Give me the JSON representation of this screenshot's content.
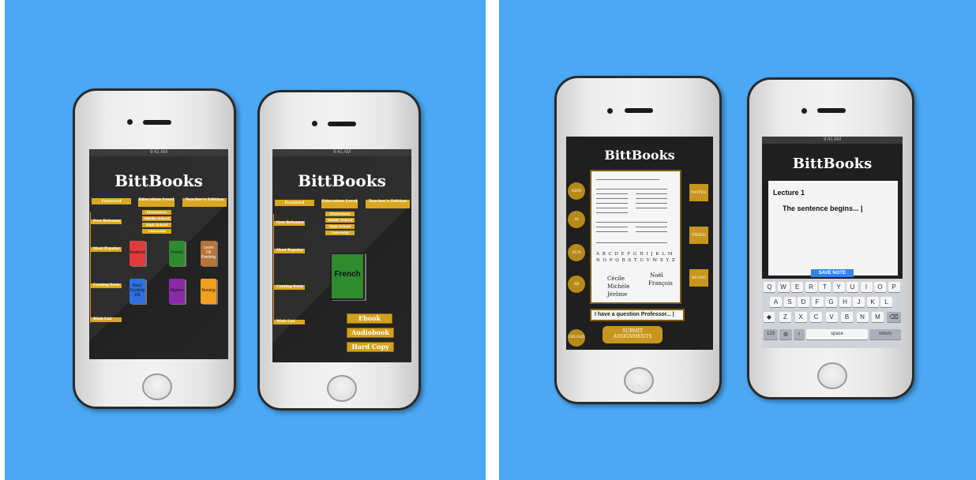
{
  "app_name": "BittBooks",
  "status_time": "9:41 AM",
  "phone1": {
    "tabs": [
      "Featured",
      "Education Level",
      "Teacher's Edition"
    ],
    "education_levels": [
      "Elementary",
      "Middle School",
      "High School",
      "University"
    ],
    "sidebar": [
      "New Releases",
      "Most Popular",
      "Coming Soon",
      "Wish List"
    ],
    "books": [
      {
        "title": "Anatomy",
        "color": "#e23a3a"
      },
      {
        "title": "French",
        "color": "#2e8b2e"
      },
      {
        "title": "Learn Oil Painting",
        "color": "#b8743a"
      },
      {
        "title": "Easy Cooking 101",
        "color": "#2f6fe0"
      },
      {
        "title": "Algebra",
        "color": "#8a2aa8"
      },
      {
        "title": "Nursing",
        "color": "#f0a020"
      }
    ]
  },
  "phone2": {
    "tabs": [
      "Featured",
      "Education Level",
      "Teacher's Edition"
    ],
    "education_levels": [
      "Elementary",
      "Middle School",
      "High School",
      "University"
    ],
    "sidebar": [
      "New Releases",
      "Most Popular",
      "Coming Soon",
      "Wish List"
    ],
    "selected_book": {
      "title": "French",
      "color": "#2e8b2e"
    },
    "formats": [
      "Ebook",
      "Audiobook",
      "Hard Copy"
    ]
  },
  "phone3": {
    "left_buttons": [
      "ADW",
      "AI",
      "AUX",
      "AB"
    ],
    "right_buttons": [
      "NOTES",
      "VIDEO",
      "AUDIO"
    ],
    "worksheet": {
      "names": [
        "Cécile",
        "Noël",
        "Michèle",
        "François",
        "Jérôme"
      ],
      "alphabet_row1": "A B C D E F G H I J K L M",
      "alphabet_row2": "N O P Q R S T U V W X Y Z"
    },
    "question_input": "I have a question Professor... |",
    "upload_label": "UPLOAD",
    "submit_label": "SUBMIT ASSIGNMENTS"
  },
  "phone4": {
    "note_title": "Lecture 1",
    "note_body": "The sentence begins... |",
    "save_label": "SAVE NOTE",
    "keyboard": {
      "row1": [
        "Q",
        "W",
        "E",
        "R",
        "T",
        "Y",
        "U",
        "I",
        "O",
        "P"
      ],
      "row2": [
        "A",
        "S",
        "D",
        "F",
        "G",
        "H",
        "J",
        "K",
        "L"
      ],
      "row3": [
        "Z",
        "X",
        "C",
        "V",
        "B",
        "N",
        "M"
      ],
      "numbers_key": "123",
      "space_label": "space",
      "return_label": "return"
    }
  },
  "colors": {
    "background": "#4aa8f5",
    "gold": "#d9a820"
  }
}
